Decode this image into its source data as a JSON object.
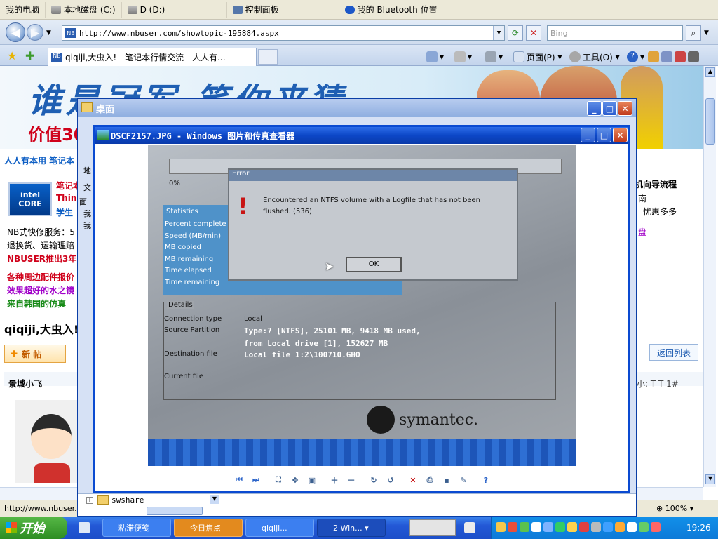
{
  "quickbar": {
    "items": [
      "我的电脑",
      "本地磁盘 (C:)",
      "D (D:)",
      "控制面板",
      "我的 Bluetooth 位置"
    ]
  },
  "browser": {
    "address": "http://www.nbuser.com/showtopic-195884.aspx",
    "search_placeholder": "Bing",
    "tab_title": "qiqiji,大虫入! - 笔记本行情交流 - 人人有...",
    "tools": {
      "page": "页面(P)",
      "tools": "工具(O)"
    },
    "status_url": "http://www.nbuser.",
    "zoom": "100%"
  },
  "page": {
    "banner_slogan": "谁是冠军 笔你来猜",
    "banner_price": "价值30",
    "nav_line": "人人有本用  笔记本",
    "intel_badge": "intel CORE",
    "links": [
      "笔记本",
      "Thin",
      "学生"
    ],
    "service_line": "NB式快修服务：5",
    "return_line": "退换货、运输理赔",
    "promo_line": "NBUSER推出3年",
    "ad_1": "各种周边配件报价",
    "ad_2": "效果超好的水之镜",
    "ad_3": "来自韩国的仿真",
    "thread_title": "qiqiji,大虫入!",
    "new_post": "新 帖",
    "username": "景城小飞",
    "right_title": "机向导流程",
    "right_line1": "南",
    "right_line2": "，忧惠多多",
    "right_link": "盘",
    "back_list": "返回列表",
    "font_size_label": "小: T T 1#"
  },
  "desktop_window": {
    "title": "桌面",
    "left_labels": [
      "地",
      "文",
      "面",
      "我",
      "我"
    ],
    "bottom_folder": "swshare"
  },
  "viewer": {
    "title": "DSCF2157.JPG - Windows 图片和传真查看器",
    "photo": {
      "percent_top": "0%",
      "stats_header": "Statistics",
      "stats": [
        "Percent complete",
        "Speed (MB/min)",
        "MB copied",
        "MB remaining",
        "Time elapsed",
        "Time remaining"
      ],
      "error_title": "Error",
      "error_msg": "Encountered an NTFS volume with a Logfile that has not been flushed. (536)",
      "ok": "OK",
      "details_header": "Details",
      "conn_label": "Connection type",
      "conn_value": "Local",
      "src_label": "Source Partition",
      "src_value1": "Type:7 [NTFS], 25101 MB, 9418 MB used,",
      "src_value2": "from Local drive [1], 152627 MB",
      "dest_label": "Destination file",
      "dest_value": "Local file 1:2\\100710.GHO",
      "curr_label": "Current file",
      "brand": "symantec."
    },
    "toolbar_icons": [
      "prev-icon",
      "next-icon",
      "best-fit-icon",
      "actual-size-icon",
      "slideshow-icon",
      "zoom-in-icon",
      "zoom-out-icon",
      "rotate-cw-icon",
      "rotate-ccw-icon",
      "delete-icon",
      "print-icon",
      "save-icon",
      "edit-icon",
      "help-icon"
    ]
  },
  "taskbar": {
    "start": "开始",
    "tasks": [
      "粘滞便笺",
      "今日焦点",
      "qiqiji...",
      "2 Win..."
    ],
    "clock": "19:26"
  }
}
